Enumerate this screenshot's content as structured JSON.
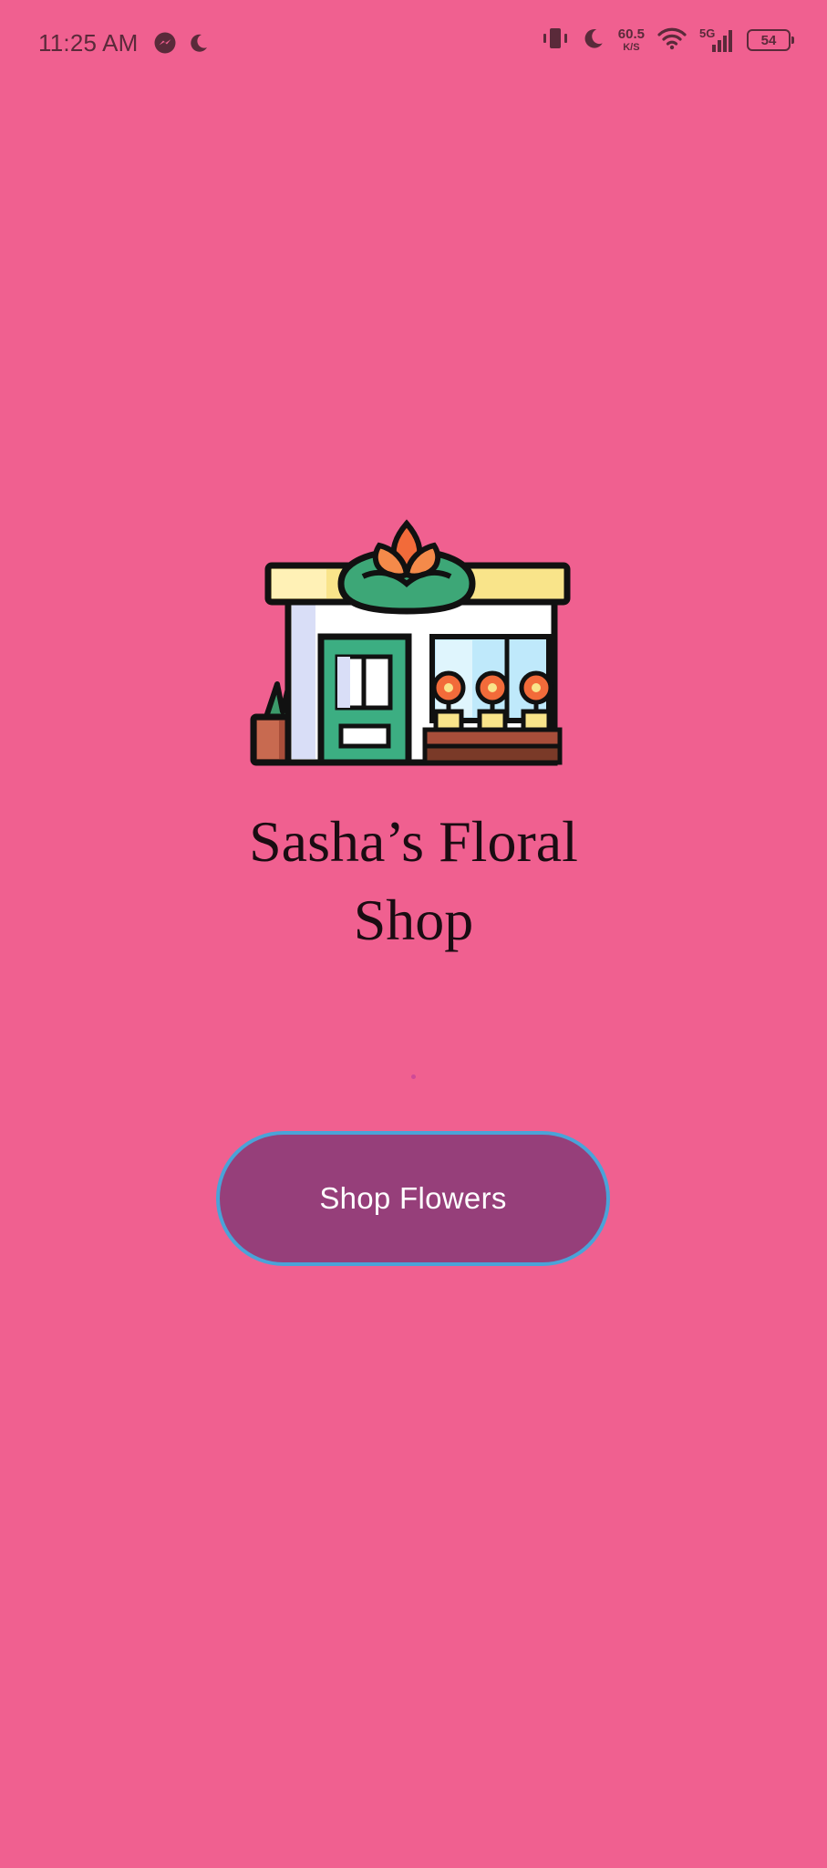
{
  "status_bar": {
    "time": "11:25 AM",
    "net_speed_value": "60.5",
    "net_speed_unit": "K/S",
    "network_type": "5G",
    "battery_level": "54",
    "left_icons": [
      "messenger-icon",
      "moon-icon"
    ],
    "right_icons": [
      "vibrate-icon",
      "moon-icon",
      "wifi-icon",
      "signal-icon",
      "battery-icon"
    ]
  },
  "app": {
    "logo_icon": "flower-shop-icon",
    "title_line1": "Sasha’s Floral",
    "title_line2": "Shop",
    "cta_label": "Shop Flowers"
  },
  "colors": {
    "background": "#f06090",
    "button_fill": "#963f7a",
    "button_border": "#4aa3d8",
    "status_text": "#5a2a3a",
    "loader_dot": "#c0409a"
  }
}
